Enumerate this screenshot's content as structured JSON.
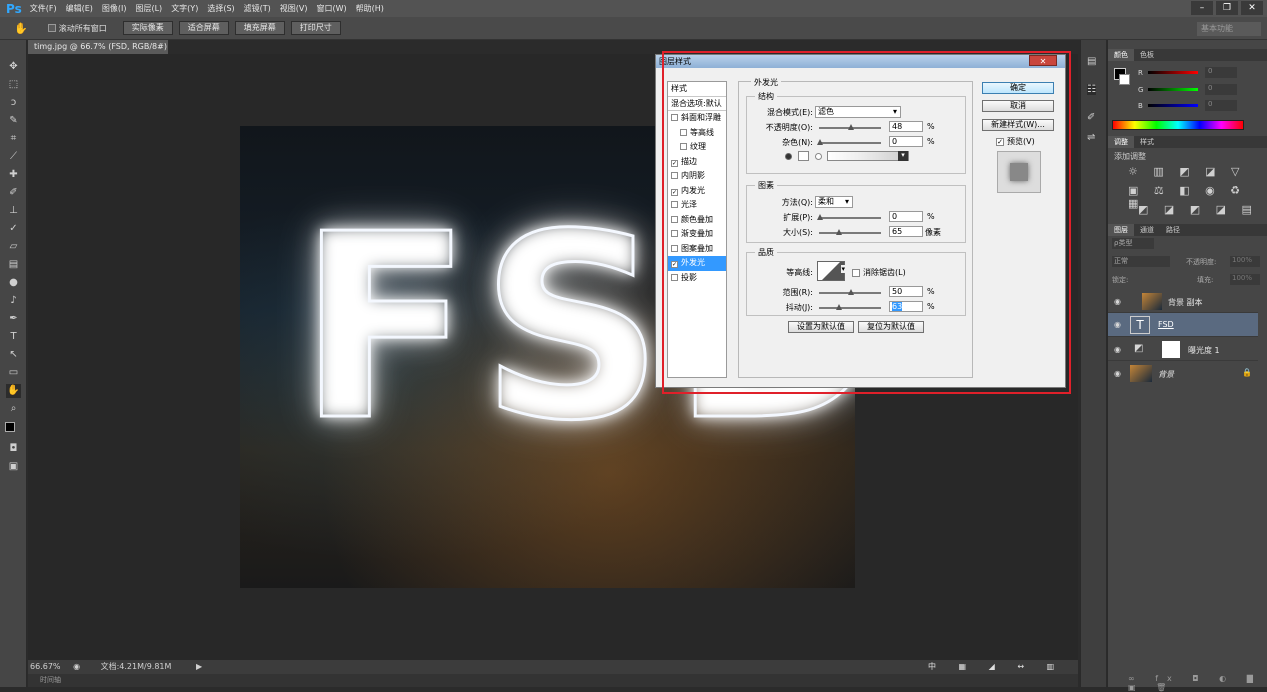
{
  "app": {
    "logo": "Ps"
  },
  "menu": [
    "文件(F)",
    "编辑(E)",
    "图像(I)",
    "图层(L)",
    "文字(Y)",
    "选择(S)",
    "滤镜(T)",
    "视图(V)",
    "窗口(W)",
    "帮助(H)"
  ],
  "options": {
    "scroll_all": "滚动所有窗口",
    "actual_pixels": "实际像素",
    "fit_screen": "适合屏幕",
    "fill_screen": "填充屏幕",
    "print_size": "打印尺寸",
    "workspace": "基本功能"
  },
  "document": {
    "tab": "timg.jpg @ 66.7% (FSD, RGB/8#) *",
    "text": "FSD"
  },
  "status": {
    "zoom": "66.67%",
    "doc": "文档:4.21M/9.81M",
    "timeline": "时间轴"
  },
  "dialog": {
    "title": "图层样式",
    "close": "✕",
    "styles_header": "样式",
    "blend_header": "混合选项:默认",
    "styles": [
      {
        "label": "斜面和浮雕",
        "checked": false,
        "indent": false
      },
      {
        "label": "等高线",
        "checked": false,
        "indent": true
      },
      {
        "label": "纹理",
        "checked": false,
        "indent": true
      },
      {
        "label": "描边",
        "checked": true,
        "indent": false
      },
      {
        "label": "内阴影",
        "checked": false,
        "indent": false
      },
      {
        "label": "内发光",
        "checked": true,
        "indent": false
      },
      {
        "label": "光泽",
        "checked": false,
        "indent": false
      },
      {
        "label": "颜色叠加",
        "checked": false,
        "indent": false
      },
      {
        "label": "渐变叠加",
        "checked": false,
        "indent": false
      },
      {
        "label": "图案叠加",
        "checked": false,
        "indent": false
      },
      {
        "label": "外发光",
        "checked": true,
        "indent": false,
        "selected": true
      },
      {
        "label": "投影",
        "checked": false,
        "indent": false
      }
    ],
    "section": "外发光",
    "structure": {
      "title": "结构",
      "blend_label": "混合模式(E):",
      "blend_value": "滤色",
      "opacity_label": "不透明度(O):",
      "opacity": "48",
      "noise_label": "杂色(N):",
      "noise": "0",
      "unit": "%"
    },
    "elements": {
      "title": "图素",
      "method_label": "方法(Q):",
      "method_value": "柔和",
      "spread_label": "扩展(P):",
      "spread": "0",
      "size_label": "大小(S):",
      "size": "65",
      "unit_pct": "%",
      "unit_px": "像素"
    },
    "quality": {
      "title": "品质",
      "contour_label": "等高线:",
      "antialias": "消除锯齿(L)",
      "range_label": "范围(R):",
      "range": "50",
      "jitter_label": "抖动(J):",
      "jitter": "63",
      "unit": "%"
    },
    "set_default": "设置为默认值",
    "reset_default": "复位为默认值",
    "ok": "确定",
    "cancel": "取消",
    "new_style": "新建样式(W)...",
    "preview": "预览(V)"
  },
  "color_panel": {
    "tabs": [
      "颜色",
      "色板"
    ],
    "channels": [
      "R",
      "G",
      "B"
    ],
    "values": [
      "0",
      "0",
      "0"
    ]
  },
  "adjust_panel": {
    "tabs": [
      "调整",
      "样式"
    ],
    "title": "添加调整"
  },
  "layers_panel": {
    "tabs": [
      "图层",
      "通道",
      "路径"
    ],
    "kind": "ρ类型",
    "blend": "正常",
    "opacity_label": "不透明度:",
    "opacity": "100%",
    "lock_label": "锁定:",
    "fill_label": "填充:",
    "fill": "100%",
    "layers": [
      "背景 副本",
      "FSD",
      "曝光度 1",
      "背景"
    ]
  },
  "colors": {
    "accent": "#31a8ff",
    "highlight": "#e0202a",
    "selected": "#3399ff"
  }
}
